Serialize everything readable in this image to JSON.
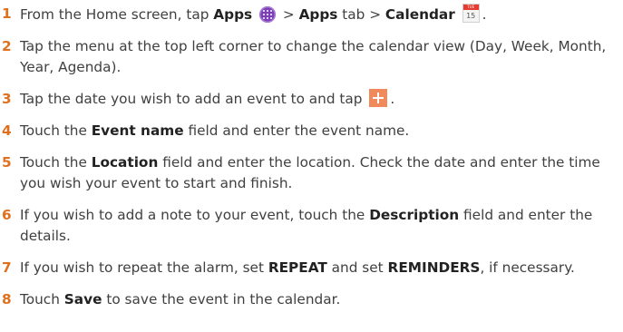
{
  "steps": [
    {
      "num": "1",
      "t1": "From the Home screen, tap ",
      "b1": "Apps",
      "t2": " > ",
      "b2": "Apps",
      "t3": " tab > ",
      "b3": "Calendar",
      "t4": "."
    },
    {
      "num": "2",
      "t1": "Tap the menu at the top left corner to change the calendar view (Day, Week, Month, Year, Agenda)."
    },
    {
      "num": "3",
      "t1": "Tap the date you wish to add an event to and tap ",
      "t2": "."
    },
    {
      "num": "4",
      "t1": "Touch the ",
      "b1": "Event name",
      "t2": " field and enter the event name."
    },
    {
      "num": "5",
      "t1": "Touch the ",
      "b1": "Location",
      "t2": " field and enter the location. Check the date and enter the time you wish your event to start and finish."
    },
    {
      "num": "6",
      "t1": "If you wish to add a note to your event, touch the ",
      "b1": "Description",
      "t2": " field and enter the details."
    },
    {
      "num": "7",
      "t1": "If you wish to repeat the alarm, set ",
      "b1": "REPEAT",
      "t2": " and set ",
      "b2": "REMINDERS",
      "t3": ", if necessary."
    },
    {
      "num": "8",
      "t1": "Touch ",
      "b1": "Save",
      "t2": " to save the event in the calendar."
    }
  ],
  "icons": {
    "apps": "apps-grid-icon",
    "calendar": "calendar-app-icon",
    "add": "add-event-plus-icon",
    "calendar_month": "TUE",
    "calendar_day": "15"
  },
  "colors": {
    "step_number": "#e0701e",
    "apps_icon": "#7b3fb6",
    "add_icon": "#f08a5d",
    "calendar_header": "#e63b2e"
  }
}
